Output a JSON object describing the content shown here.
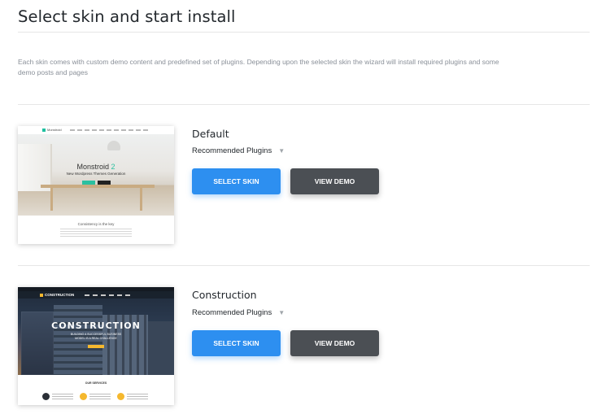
{
  "page": {
    "title": "Select skin and start install",
    "description": "Each skin comes with custom demo content and predefined set of plugins. Depending upon the selected skin the wizard will install required plugins and some demo posts and pages"
  },
  "skins": [
    {
      "name": "Default",
      "plugins_label": "Recommended Plugins",
      "select_label": "SELECT SKIN",
      "demo_label": "VIEW DEMO",
      "thumb": {
        "logo": "Monstroid",
        "headline": "Monstroid",
        "headline_accent": "2",
        "subheadline": "New Wordpress Themes Generation",
        "section_title": "Consistency is the key"
      }
    },
    {
      "name": "Construction",
      "plugins_label": "Recommended Plugins",
      "select_label": "SELECT SKIN",
      "demo_label": "VIEW DEMO",
      "thumb": {
        "logo": "CONSTRUCTION",
        "headline": "CONSTRUCTION",
        "subheadline": "BUILDING A SUCCESSFUL BUSINESS MODEL IS A REAL CHALLENGE",
        "section_title": "OUR SERVICES"
      }
    }
  ],
  "colors": {
    "select_button": "#2d8ff0",
    "demo_button": "#4b4f54",
    "accent_default": "#2bc0a0",
    "accent_construction": "#f5b82e"
  },
  "icons": {
    "plugins_toggle": "caret-down-icon"
  }
}
